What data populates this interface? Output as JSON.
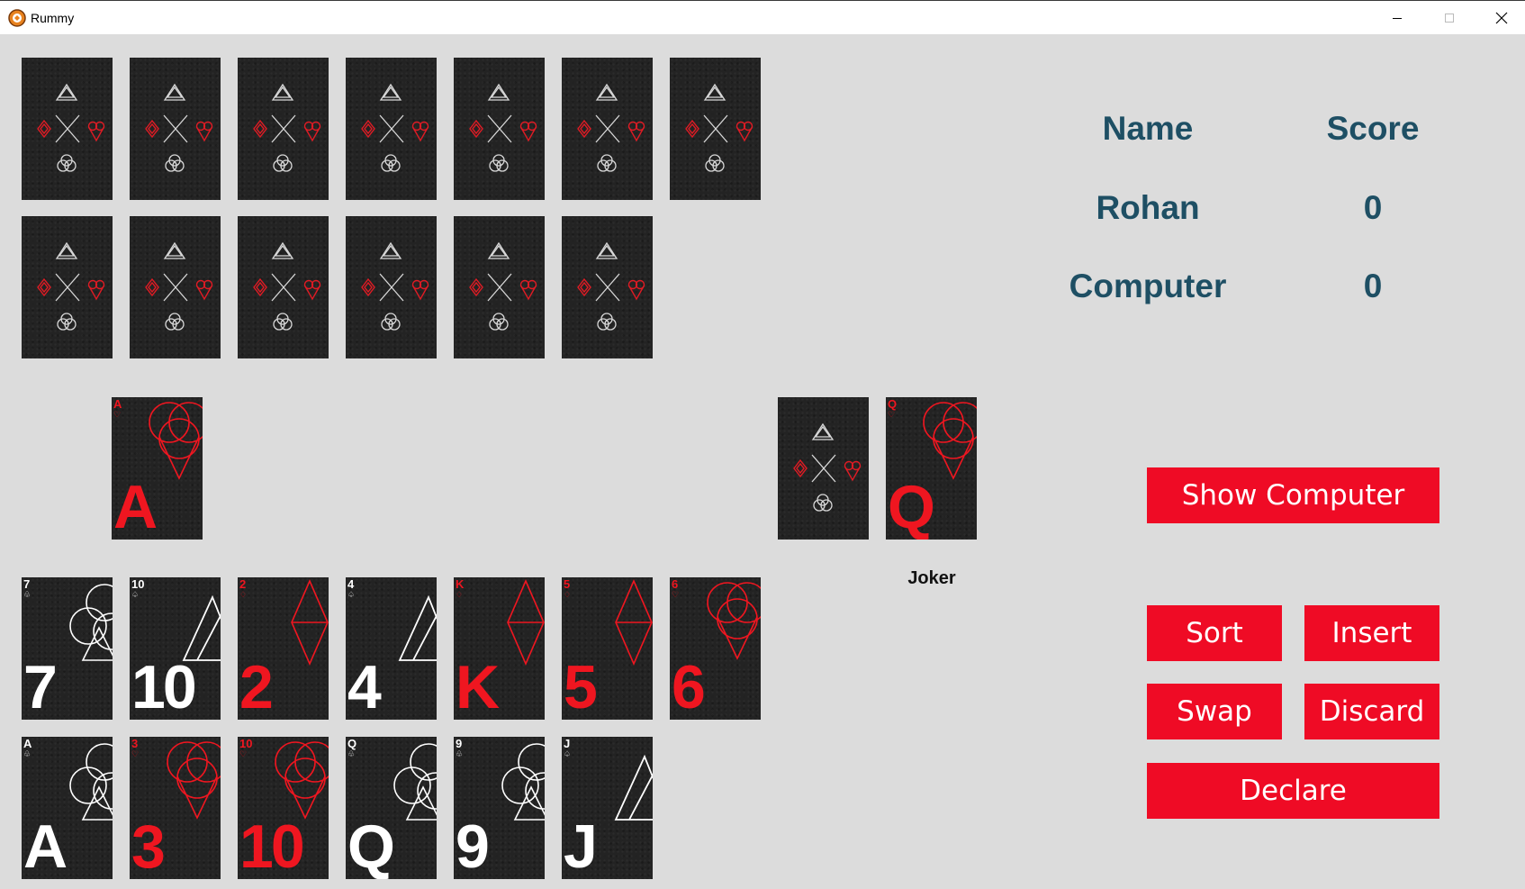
{
  "window": {
    "title": "Rummy"
  },
  "scoreboard": {
    "header_name": "Name",
    "header_score": "Score",
    "rows": [
      {
        "name": "Rohan",
        "score": "0"
      },
      {
        "name": "Computer",
        "score": "0"
      }
    ]
  },
  "opponent_hand": {
    "card_count": 13,
    "face": "down"
  },
  "open_card": {
    "rank": "A",
    "suit": "heart",
    "color": "red"
  },
  "closed_deck": {
    "face": "down"
  },
  "joker": {
    "rank": "Q",
    "suit": "heart",
    "color": "red",
    "label": "Joker"
  },
  "player_hand": [
    {
      "rank": "7",
      "suit": "club",
      "color": "white"
    },
    {
      "rank": "10",
      "suit": "spade",
      "color": "white"
    },
    {
      "rank": "2",
      "suit": "diamond",
      "color": "red"
    },
    {
      "rank": "4",
      "suit": "spade",
      "color": "white"
    },
    {
      "rank": "K",
      "suit": "diamond",
      "color": "red"
    },
    {
      "rank": "5",
      "suit": "diamond",
      "color": "red"
    },
    {
      "rank": "6",
      "suit": "heart",
      "color": "red"
    },
    {
      "rank": "A",
      "suit": "club",
      "color": "white"
    },
    {
      "rank": "3",
      "suit": "heart",
      "color": "red"
    },
    {
      "rank": "10",
      "suit": "heart",
      "color": "red"
    },
    {
      "rank": "Q",
      "suit": "club",
      "color": "white"
    },
    {
      "rank": "9",
      "suit": "club",
      "color": "white"
    },
    {
      "rank": "J",
      "suit": "spade",
      "color": "white"
    }
  ],
  "buttons": {
    "show_computer": "Show Computer",
    "sort": "Sort",
    "insert": "Insert",
    "swap": "Swap",
    "discard": "Discard",
    "declare": "Declare"
  },
  "colors": {
    "button": "#ef0b25",
    "score_text": "#1e4f64",
    "card_red": "#ef1620",
    "card_bg": "#232323",
    "table": "#dcdcdc"
  }
}
